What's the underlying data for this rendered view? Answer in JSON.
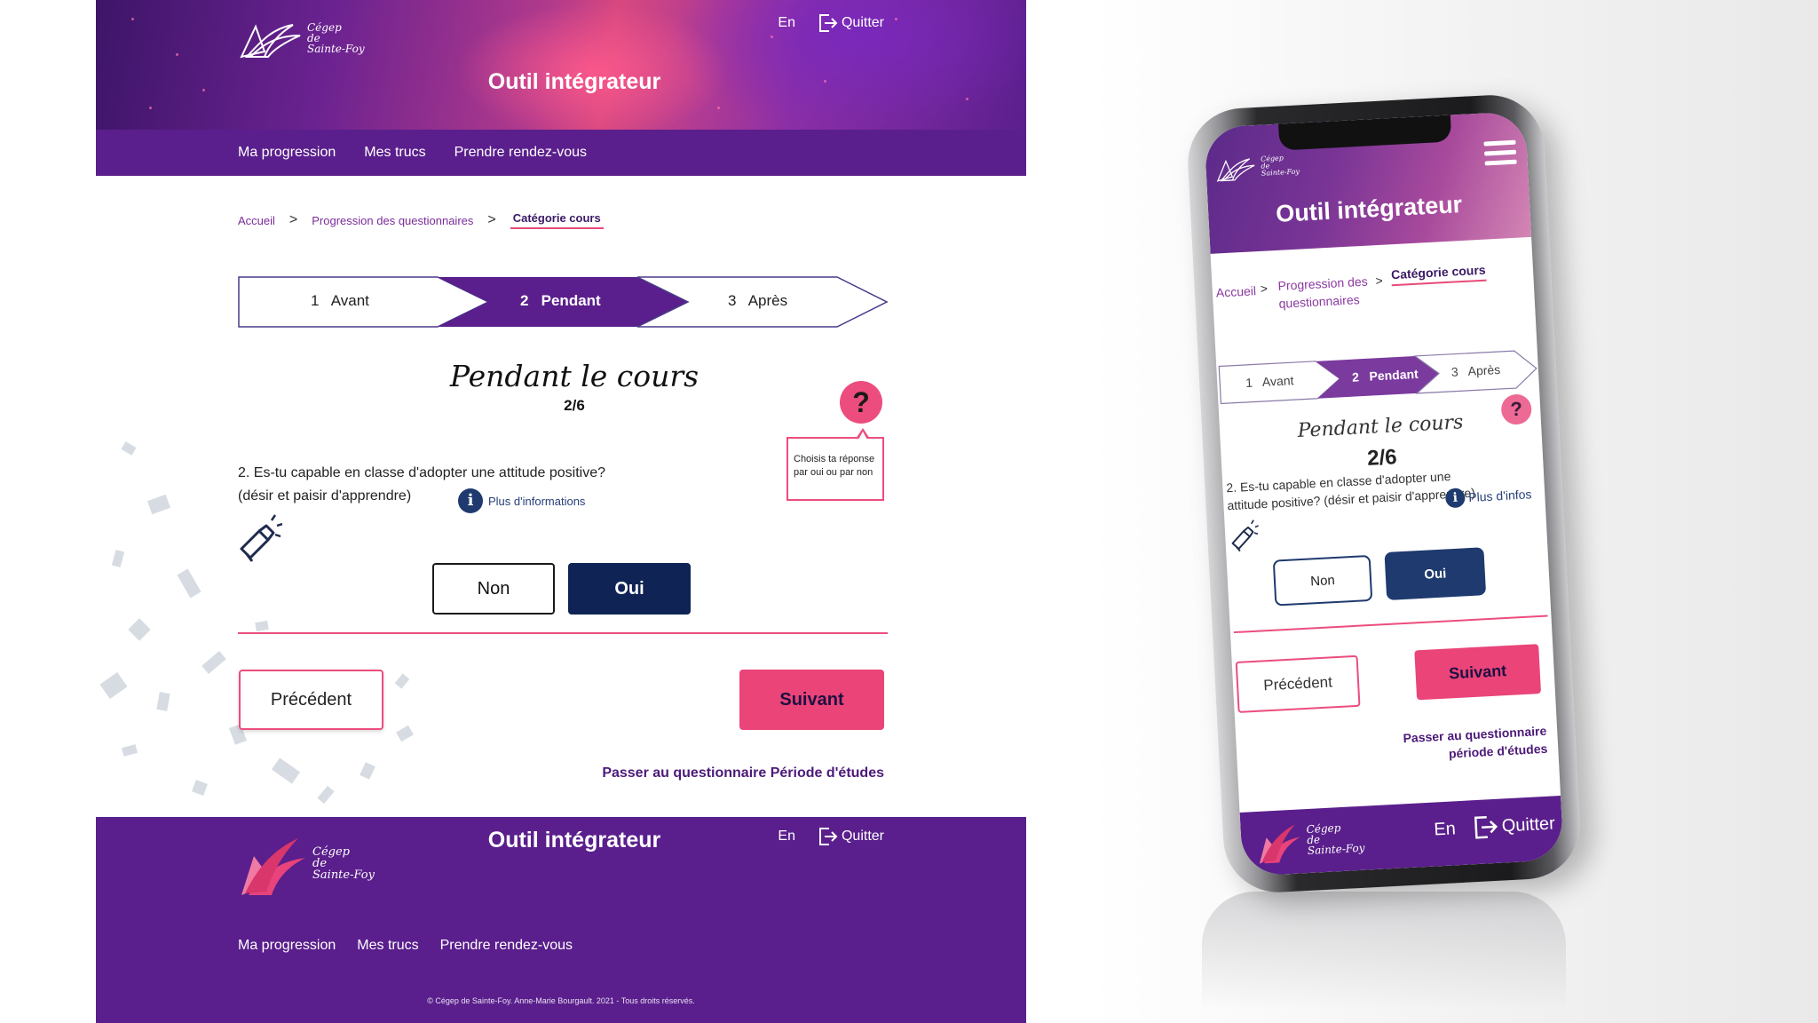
{
  "app": {
    "logo_text_line1": "Cégep",
    "logo_text_line2": "de",
    "logo_text_line3": "Sainte-Foy",
    "title": "Outil intégrateur",
    "lang": "En",
    "quit": "Quitter"
  },
  "nav": [
    "Ma progression",
    "Mes trucs",
    "Prendre rendez-vous"
  ],
  "breadcrumb": {
    "home": "Accueil",
    "progress": "Progression des questionnaires",
    "current": "Catégorie cours"
  },
  "stepper": [
    {
      "num": "1",
      "label": "Avant",
      "active": false
    },
    {
      "num": "2",
      "label": "Pendant",
      "active": true
    },
    {
      "num": "3",
      "label": "Après",
      "active": false
    }
  ],
  "question": {
    "title": "Pendant le cours",
    "count": "2/6",
    "text_line1": "2. Es-tu capable en classe d'adopter une attitude positive?",
    "text_line2": "(désir et paisir d'apprendre)",
    "more_info": "Plus d'informations",
    "help_symbol": "?",
    "tooltip_line1": "Choisis ta réponse",
    "tooltip_line2": "par oui ou par non",
    "answer_no": "Non",
    "answer_yes": "Oui",
    "selected": "Oui"
  },
  "actions": {
    "previous": "Précédent",
    "next": "Suivant",
    "skip": "Passer au questionnaire Période d'études"
  },
  "footer": {
    "copyright": "© Cégep de Sainte-Foy. Anne-Marie Bourgault. 2021 - Tous droits réservés."
  },
  "mobile": {
    "breadcrumb_progress": "Progression des questionnaires",
    "question_text": "2. Es-tu capable en classe d'adopter une attitude positive? (désir et paisir d'apprendre)",
    "more_info": "Plus d'infos",
    "skip": "Passer au questionnaire période d'études"
  },
  "colors": {
    "purple": "#5a1f8c",
    "pink": "#ea4479",
    "navy": "#0f2454"
  },
  "icons": [
    "cegep-logo-icon",
    "exit-icon",
    "help-icon",
    "info-icon",
    "megaphone-icon",
    "hamburger-menu-icon"
  ]
}
